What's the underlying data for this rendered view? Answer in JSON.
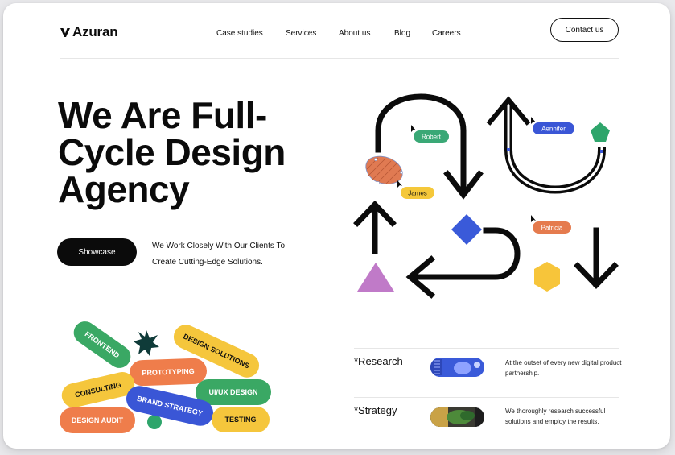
{
  "header": {
    "logo_text": "Azuran",
    "nav": [
      "Case studies",
      "Services",
      "About us",
      "Blog",
      "Careers"
    ],
    "contact_label": "Contact us"
  },
  "hero": {
    "title_lines": [
      "We Are Full-",
      "Cycle Design",
      "Agency"
    ],
    "showcase_label": "Showcase",
    "subtitle_lines": [
      "We Work Closely With Our Clients To",
      "Create Cutting-Edge Solutions."
    ]
  },
  "illustration": {
    "cursor_tags": [
      {
        "name": "Robert",
        "color": "#3aa876"
      },
      {
        "name": "Aennifer",
        "color": "#3a56d6"
      },
      {
        "name": "James",
        "color": "#f5c83a"
      },
      {
        "name": "Patricia",
        "color": "#e57b4e"
      }
    ],
    "shape_colors": {
      "pentagon": "#2ea56b",
      "diamond": "#3a5ad9",
      "hexagon": "#f7c53a",
      "triangle": "#c07ac8",
      "blob": "#e07a52"
    }
  },
  "tags": [
    {
      "label": "FRONTEND",
      "color": "#3aa864",
      "text_color": "#ffffff"
    },
    {
      "label": "DESIGN SOLUTIONS",
      "color": "#f5c63c",
      "text_color": "#111111"
    },
    {
      "label": "PROTOTYPING",
      "color": "#ef7d4b",
      "text_color": "#ffffff"
    },
    {
      "label": "CONSULTING",
      "color": "#f5c63c",
      "text_color": "#111111"
    },
    {
      "label": "UI/UX DESIGN",
      "color": "#3aa864",
      "text_color": "#ffffff"
    },
    {
      "label": "BRAND STRATEGY",
      "color": "#3a56d6",
      "text_color": "#ffffff"
    },
    {
      "label": "DESIGN AUDIT",
      "color": "#ef7d4b",
      "text_color": "#ffffff"
    },
    {
      "label": "TESTING",
      "color": "#f5c63c",
      "text_color": "#111111"
    }
  ],
  "services": [
    {
      "title": "*Research",
      "desc": "At the outset of every new digital product partnership."
    },
    {
      "title": "*Strategy",
      "desc": "We thoroughly research successful solutions and employ the results."
    }
  ],
  "colors": {
    "ink": "#0b0b0b",
    "background": "#ffffff",
    "accent_green": "#3aa864",
    "accent_yellow": "#f5c63c",
    "accent_orange": "#ef7d4b",
    "accent_blue": "#3a56d6"
  }
}
